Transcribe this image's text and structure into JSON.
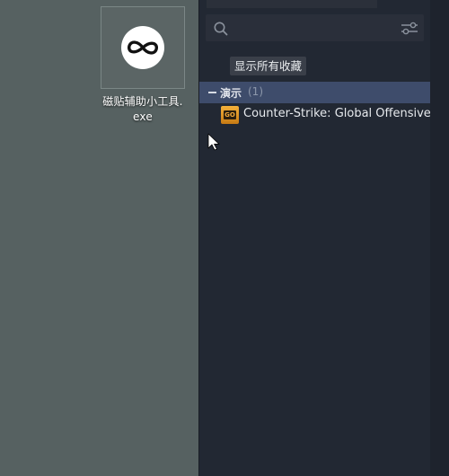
{
  "desktop": {
    "icon": {
      "name": "infinity-icon",
      "caption": "磁贴辅助小工具.\nexe"
    }
  },
  "library": {
    "search": {
      "placeholder": "",
      "icon": "search-icon"
    },
    "filter_icon": "filter-sliders-icon",
    "tooltip": "显示所有收藏",
    "collection": {
      "name": "演示",
      "count": "(1)"
    },
    "games": [
      {
        "title": "Counter-Strike: Global Offensive",
        "icon": "csgo-icon",
        "icon_text": "GO"
      }
    ]
  },
  "colors": {
    "desktop_bg": "#566161",
    "panel_bg": "#222833",
    "collection_header_bg": "#3e4c6b",
    "tooltip_bg": "#3a3f49"
  }
}
